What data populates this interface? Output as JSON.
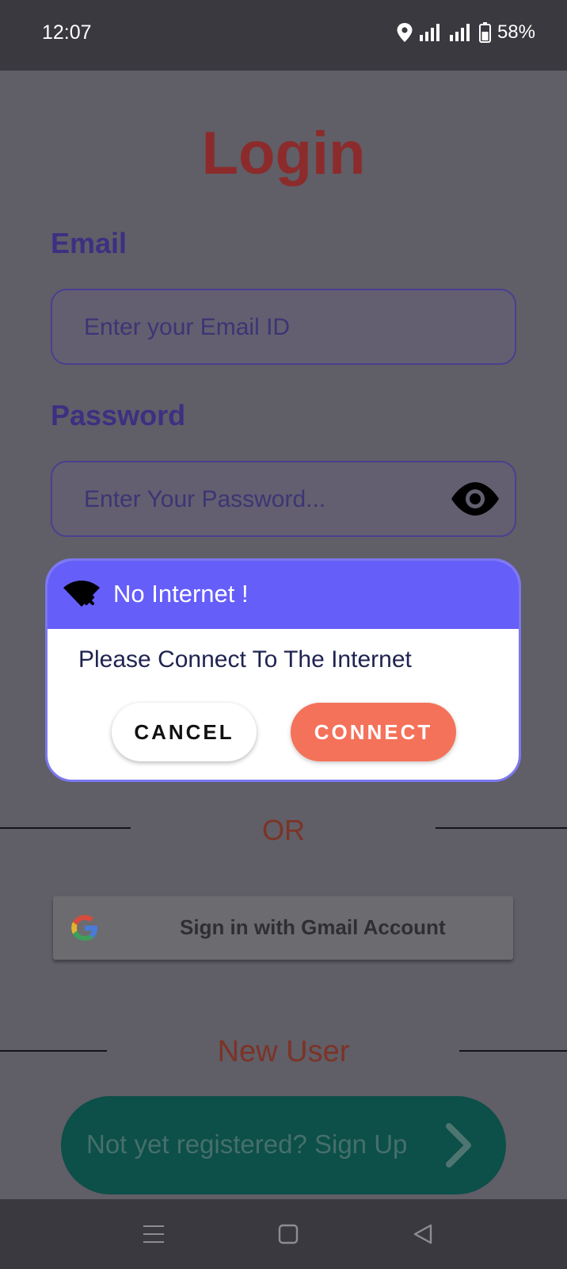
{
  "status_bar": {
    "time": "12:07",
    "battery": "58%"
  },
  "login": {
    "title": "Login",
    "email_label": "Email",
    "email_placeholder": "Enter your Email ID",
    "password_label": "Password",
    "password_placeholder": "Enter Your Password..."
  },
  "dialog": {
    "title": "No Internet !",
    "message": "Please Connect To The Internet",
    "cancel_label": "CANCEL",
    "connect_label": "CONNECT"
  },
  "or_text": "OR",
  "gmail_label": "Sign in with Gmail Account",
  "new_user_text": "New User",
  "signup_label": "Not yet registered? Sign Up",
  "colors": {
    "title": "#8c2b2b",
    "label": "#3c3082",
    "dialog_header": "#655ef9",
    "connect": "#f4725a",
    "signup": "#0d4f49"
  },
  "icons": [
    "location-icon",
    "signal-icon",
    "battery-icon",
    "eye-icon",
    "wifi-off-icon",
    "google-g-icon",
    "chevron-right-icon",
    "menu-icon",
    "home-icon",
    "back-icon"
  ]
}
